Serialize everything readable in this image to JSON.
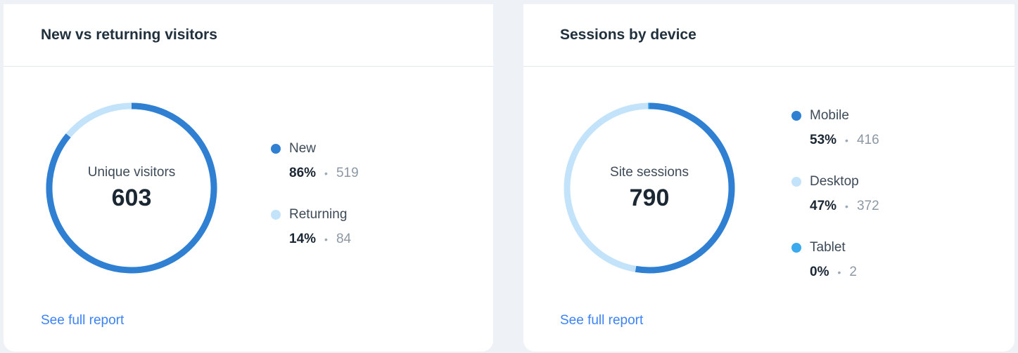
{
  "visitors_card": {
    "title": "New vs returning visitors",
    "center_label": "Unique visitors",
    "total": "603",
    "segments": [
      {
        "name": "New",
        "percent_label": "86%",
        "count": "519",
        "value": 519,
        "color": "#2f7fd3"
      },
      {
        "name": "Returning",
        "percent_label": "14%",
        "count": "84",
        "value": 84,
        "color": "#c3e3fb"
      }
    ],
    "separator": "•",
    "link": "See full report"
  },
  "sessions_card": {
    "title": "Sessions by device",
    "center_label": "Site sessions",
    "total": "790",
    "segments": [
      {
        "name": "Mobile",
        "percent_label": "53%",
        "count": "416",
        "value": 416,
        "color": "#2f7fd3"
      },
      {
        "name": "Desktop",
        "percent_label": "47%",
        "count": "372",
        "value": 372,
        "color": "#c3e3fb"
      },
      {
        "name": "Tablet",
        "percent_label": "0%",
        "count": "2",
        "value": 2,
        "color": "#3ba9ee"
      }
    ],
    "separator": "•",
    "link": "See full report"
  }
}
